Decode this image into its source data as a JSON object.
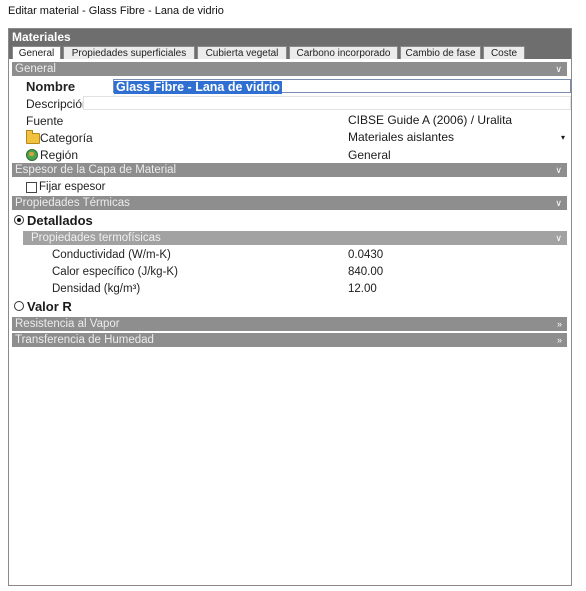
{
  "window": {
    "title": "Editar material - Glass Fibre - Lana de vidrio"
  },
  "header": {
    "title": "Materiales"
  },
  "tabs": [
    {
      "label": "General"
    },
    {
      "label": "Propiedades superficiales"
    },
    {
      "label": "Cubierta vegetal"
    },
    {
      "label": "Carbono incorporado"
    },
    {
      "label": "Cambio de fase"
    },
    {
      "label": "Coste"
    }
  ],
  "general": {
    "header": "General",
    "nombre_label": "Nombre",
    "nombre_value": "Glass Fibre - Lana de vidrio",
    "descripcion_label": "Descripción",
    "descripcion_value": "",
    "fuente_label": "Fuente",
    "fuente_value": "CIBSE Guide A (2006) / Uralita",
    "categoria_label": "Categoría",
    "categoria_value": "Materiales aislantes",
    "region_label": "Región",
    "region_value": "General"
  },
  "espesor": {
    "header": "Espesor de la Capa de Material",
    "fijar_label": "Fijar espesor",
    "fijar_checked": false
  },
  "termicas": {
    "header": "Propiedades Térmicas",
    "detallados_label": "Detallados",
    "detallados_selected": true,
    "termofisicas_header": "Propiedades termofísicas",
    "conductividad_label": "Conductividad (W/m-K)",
    "conductividad_value": "0.0430",
    "calor_label": "Calor específico (J/kg-K)",
    "calor_value": "840.00",
    "densidad_label": "Densidad (kg/m³)",
    "densidad_value": "12.00",
    "valor_r_label": "Valor R",
    "valor_r_selected": false
  },
  "vapor": {
    "header": "Resistencia al Vapor"
  },
  "humedad": {
    "header": "Transferencia de Humedad"
  },
  "icons": {
    "expand_chevron": "»",
    "collapse_chevron": "«",
    "dropdown_arrow": "▾"
  }
}
